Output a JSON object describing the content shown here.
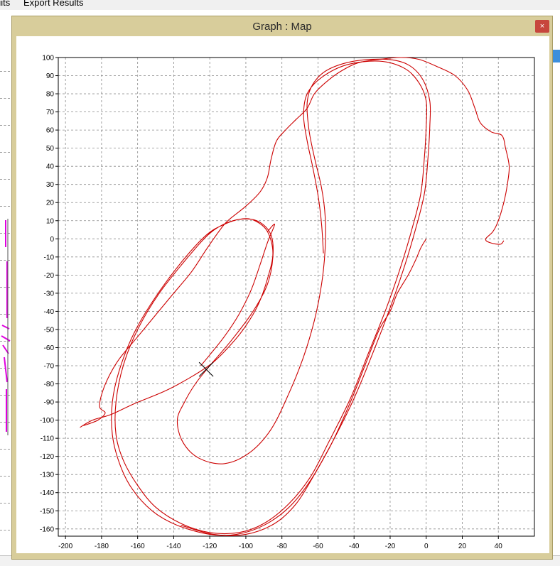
{
  "menu": {
    "results_label": "uits",
    "export_label": "Export Results"
  },
  "window": {
    "title": "Graph : Map",
    "close_label": "×"
  },
  "chart_data": {
    "type": "line",
    "xlim": [
      -204,
      60
    ],
    "ylim": [
      -164,
      100
    ],
    "x_ticks": [
      -200,
      -180,
      -160,
      -140,
      -120,
      -100,
      -80,
      -60,
      -40,
      -20,
      0,
      20,
      40
    ],
    "y_ticks": [
      100,
      90,
      80,
      70,
      60,
      50,
      40,
      30,
      20,
      10,
      0,
      -10,
      -20,
      -30,
      -40,
      -50,
      -60,
      -70,
      -80,
      -90,
      -100,
      -110,
      -120,
      -130,
      -140,
      -150,
      -160
    ],
    "grid": true,
    "line_color": "#cc0000",
    "marker": {
      "x": -122,
      "y": -72
    },
    "series": [
      {
        "points": [
          [
            -192,
            -104
          ],
          [
            -185,
            -100
          ],
          [
            -175,
            -97
          ],
          [
            -162,
            -91
          ],
          [
            -145,
            -84
          ],
          [
            -130,
            -76
          ],
          [
            -118,
            -68
          ],
          [
            -108,
            -58
          ],
          [
            -100,
            -48
          ],
          [
            -93,
            -36
          ],
          [
            -88,
            -22
          ],
          [
            -85,
            -8
          ],
          [
            -88,
            4
          ],
          [
            -95,
            10
          ],
          [
            -102,
            11
          ],
          [
            -112,
            8
          ],
          [
            -122,
            2
          ],
          [
            -135,
            -12
          ],
          [
            -150,
            -32
          ],
          [
            -162,
            -52
          ],
          [
            -170,
            -72
          ],
          [
            -174,
            -90
          ],
          [
            -174,
            -108
          ],
          [
            -170,
            -124
          ],
          [
            -163,
            -138
          ],
          [
            -152,
            -150
          ],
          [
            -138,
            -158
          ],
          [
            -120,
            -163
          ],
          [
            -105,
            -163
          ],
          [
            -90,
            -158
          ],
          [
            -76,
            -148
          ],
          [
            -64,
            -133
          ],
          [
            -52,
            -112
          ],
          [
            -40,
            -88
          ],
          [
            -30,
            -64
          ],
          [
            -20,
            -38
          ],
          [
            -12,
            -15
          ],
          [
            -6,
            5
          ],
          [
            -1,
            25
          ],
          [
            1,
            45
          ],
          [
            2,
            62
          ],
          [
            2,
            76
          ],
          [
            -2,
            88
          ],
          [
            -10,
            96
          ],
          [
            -22,
            99
          ],
          [
            -40,
            98
          ],
          [
            -55,
            93
          ],
          [
            -63,
            85
          ],
          [
            -66,
            75
          ],
          [
            -65,
            60
          ],
          [
            -62,
            45
          ],
          [
            -58,
            28
          ],
          [
            -56,
            12
          ],
          [
            -56,
            -5
          ],
          [
            -58,
            -25
          ],
          [
            -62,
            -45
          ],
          [
            -68,
            -65
          ],
          [
            -76,
            -85
          ],
          [
            -86,
            -105
          ],
          [
            -98,
            -118
          ],
          [
            -112,
            -124
          ],
          [
            -126,
            -121
          ],
          [
            -135,
            -112
          ],
          [
            -138,
            -100
          ],
          [
            -134,
            -90
          ],
          [
            -128,
            -80
          ],
          [
            -120,
            -70
          ],
          [
            -108,
            -56
          ],
          [
            -96,
            -40
          ],
          [
            -88,
            -25
          ],
          [
            -85,
            -10
          ],
          [
            -86,
            2
          ],
          [
            -92,
            9
          ],
          [
            -100,
            11
          ],
          [
            -110,
            9
          ],
          [
            -120,
            3
          ],
          [
            -132,
            -10
          ],
          [
            -148,
            -30
          ],
          [
            -160,
            -50
          ],
          [
            -168,
            -70
          ],
          [
            -172,
            -90
          ],
          [
            -172,
            -108
          ],
          [
            -168,
            -122
          ],
          [
            -160,
            -136
          ],
          [
            -150,
            -148
          ],
          [
            -136,
            -157
          ],
          [
            -120,
            -162
          ],
          [
            -104,
            -162
          ],
          [
            -90,
            -157
          ],
          [
            -76,
            -146
          ],
          [
            -64,
            -131
          ],
          [
            -54,
            -112
          ],
          [
            -42,
            -88
          ],
          [
            -32,
            -63
          ],
          [
            -22,
            -38
          ],
          [
            -14,
            -15
          ],
          [
            -8,
            5
          ],
          [
            -3,
            25
          ],
          [
            -1,
            45
          ],
          [
            0,
            62
          ],
          [
            0,
            76
          ],
          [
            -4,
            86
          ],
          [
            -12,
            94
          ],
          [
            -26,
            98
          ],
          [
            -44,
            96
          ],
          [
            -58,
            89
          ],
          [
            -66,
            80
          ],
          [
            -68,
            68
          ],
          [
            -66,
            54
          ],
          [
            -63,
            40
          ],
          [
            -60,
            24
          ],
          [
            -58,
            8
          ],
          [
            -57,
            -8
          ]
        ]
      },
      {
        "points": [
          [
            -125,
            -70
          ],
          [
            -120,
            -64
          ],
          [
            -112,
            -54
          ],
          [
            -104,
            -42
          ],
          [
            -97,
            -28
          ],
          [
            -92,
            -14
          ],
          [
            -88,
            -2
          ],
          [
            -84,
            8
          ],
          [
            -88,
            4
          ]
        ]
      },
      {
        "points": [
          [
            -190,
            -103
          ],
          [
            -182,
            -100
          ],
          [
            -178,
            -96
          ],
          [
            -181,
            -93
          ],
          [
            -180,
            -86
          ],
          [
            -176,
            -76
          ],
          [
            -170,
            -66
          ],
          [
            -160,
            -54
          ],
          [
            -150,
            -42
          ],
          [
            -140,
            -30
          ],
          [
            -130,
            -18
          ],
          [
            -122,
            -6
          ],
          [
            -115,
            4
          ],
          [
            -110,
            10
          ],
          [
            -100,
            18
          ],
          [
            -92,
            26
          ],
          [
            -88,
            34
          ],
          [
            -86,
            44
          ],
          [
            -83,
            54
          ],
          [
            -78,
            60
          ],
          [
            -72,
            66
          ],
          [
            -66,
            72
          ],
          [
            -62,
            80
          ],
          [
            -56,
            86
          ],
          [
            -48,
            92
          ],
          [
            -38,
            97
          ],
          [
            -26,
            99
          ],
          [
            -14,
            100
          ],
          [
            -4,
            99
          ],
          [
            6,
            95
          ],
          [
            16,
            90
          ],
          [
            23,
            82
          ],
          [
            27,
            72
          ],
          [
            30,
            64
          ],
          [
            36,
            59
          ],
          [
            42,
            57
          ],
          [
            44,
            50
          ],
          [
            46,
            40
          ],
          [
            45,
            30
          ],
          [
            43,
            20
          ],
          [
            40,
            10
          ],
          [
            37,
            4
          ],
          [
            33,
            0
          ],
          [
            35,
            -2
          ],
          [
            41,
            -3
          ],
          [
            43,
            -1
          ]
        ]
      },
      {
        "points": [
          [
            0,
            0
          ],
          [
            -3,
            -5
          ],
          [
            -6,
            -12
          ],
          [
            -10,
            -20
          ],
          [
            -16,
            -30
          ],
          [
            -20,
            -40
          ],
          [
            -26,
            -50
          ],
          [
            -34,
            -70
          ],
          [
            -42,
            -90
          ],
          [
            -52,
            -112
          ],
          [
            -62,
            -130
          ],
          [
            -72,
            -146
          ],
          [
            -84,
            -157
          ],
          [
            -100,
            -163
          ],
          [
            -118,
            -163
          ],
          [
            -136,
            -158
          ]
        ]
      }
    ]
  }
}
